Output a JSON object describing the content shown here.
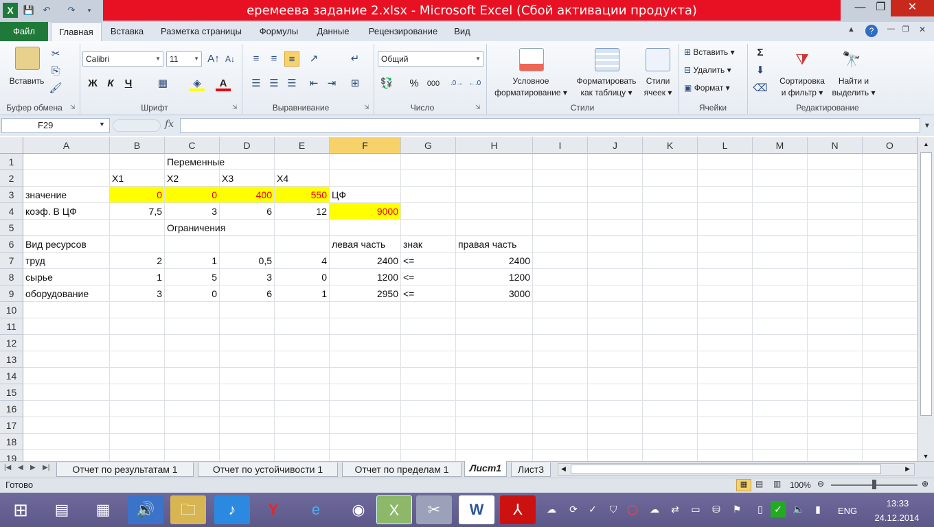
{
  "window": {
    "title": "еремеева задание 2.xlsx - Microsoft Excel (Сбой активации продукта)",
    "app_icon": "X",
    "quick_access": [
      "save-icon",
      "undo-icon",
      "redo-icon",
      "customize-icon"
    ],
    "controls": {
      "minimize": "—",
      "restore": "❐",
      "close": "✕"
    }
  },
  "ribbon_tabs": [
    "Файл",
    "Главная",
    "Вставка",
    "Разметка страницы",
    "Формулы",
    "Данные",
    "Рецензирование",
    "Вид"
  ],
  "ribbon": {
    "clipboard": {
      "paste_label": "Вставить",
      "group": "Буфер обмена"
    },
    "font": {
      "name": "Calibri",
      "size": "11",
      "bold": "Ж",
      "italic": "К",
      "underline": "Ч",
      "group": "Шрифт"
    },
    "alignment": {
      "group": "Выравнивание"
    },
    "number": {
      "format": "Общий",
      "percent": "%",
      "thousands": "000",
      "group": "Число"
    },
    "styles": {
      "conditional_line1": "Условное",
      "conditional_line2": "форматирование",
      "format_table_line1": "Форматировать",
      "format_table_line2": "как таблицу",
      "cell_styles_line1": "Стили",
      "cell_styles_line2": "ячеек",
      "group": "Стили"
    },
    "cells": {
      "insert": "Вставить",
      "delete": "Удалить",
      "format": "Формат",
      "group": "Ячейки"
    },
    "editing": {
      "sort_line1": "Сортировка",
      "sort_line2": "и фильтр",
      "find_line1": "Найти и",
      "find_line2": "выделить",
      "sigma": "Σ",
      "group": "Редактирование"
    }
  },
  "formula_bar": {
    "name_box": "F29",
    "fx": "fx",
    "value": ""
  },
  "columns": [
    "A",
    "B",
    "C",
    "D",
    "E",
    "F",
    "G",
    "H",
    "I",
    "J",
    "K",
    "L",
    "M",
    "N",
    "O"
  ],
  "selected_column": "F",
  "rows": [
    "1",
    "2",
    "3",
    "4",
    "5",
    "6",
    "7",
    "8",
    "9",
    "10",
    "11",
    "12",
    "13",
    "14",
    "15",
    "16",
    "17",
    "18",
    "19"
  ],
  "cells": {
    "C1": "Переменные",
    "B2": "X1",
    "C2": "X2",
    "D2": "X3",
    "E2": "X4",
    "A3": "значение",
    "B3": "0",
    "C3": "0",
    "D3": "400",
    "E3": "550",
    "F3": "ЦФ",
    "A4": "коэф. В ЦФ",
    "B4": "7,5",
    "C4": "3",
    "D4": "6",
    "E4": "12",
    "F4": "9000",
    "C5": "Ограничения",
    "A6": "Вид ресурсов",
    "F6": "левая часть",
    "G6": "знак",
    "H6": "правая часть",
    "A7": "труд",
    "B7": "2",
    "C7": "1",
    "D7": "0,5",
    "E7": "4",
    "F7": "2400",
    "G7": "<=",
    "H7": "2400",
    "A8": "сырье",
    "B8": "1",
    "C8": "5",
    "D8": "3",
    "E8": "0",
    "F8": "1200",
    "G8": "<=",
    "H8": "1200",
    "A9": "оборудование",
    "B9": "3",
    "C9": "0",
    "D9": "6",
    "E9": "1",
    "F9": "2950",
    "G9": "<=",
    "H9": "3000"
  },
  "sheet_tabs": [
    "Отчет по результатам 1",
    "Отчет по устойчивости 1",
    "Отчет по пределам 1",
    "Лист1",
    "Лист3"
  ],
  "active_sheet": "Лист1",
  "status": {
    "ready": "Готово",
    "zoom": "100%"
  },
  "taskbar": {
    "lang": "ENG",
    "time": "13:33",
    "date": "24.12.2014"
  },
  "colors": {
    "excel_green": "#1f7a3a",
    "title_red": "#e81123",
    "highlight_yellow": "#ffff00",
    "value_red": "#e00000"
  }
}
